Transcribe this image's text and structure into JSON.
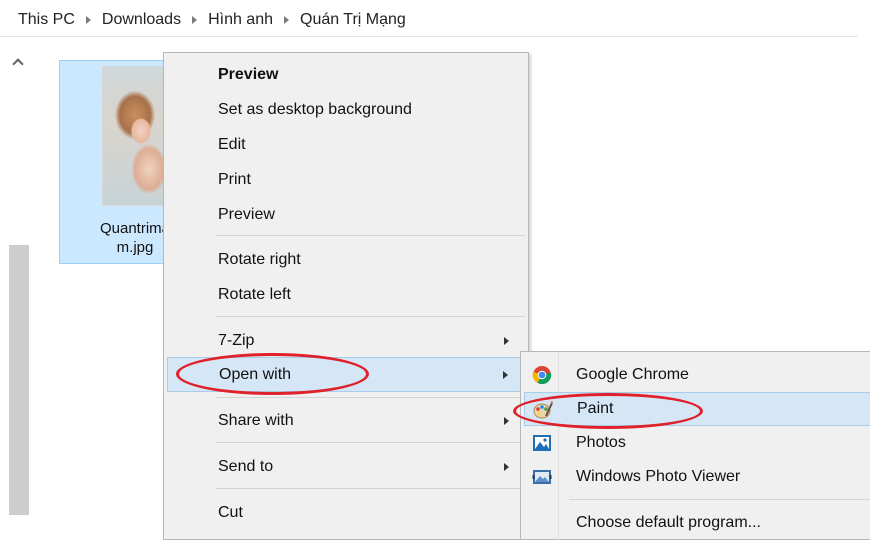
{
  "breadcrumb": {
    "items": [
      "This PC",
      "Downloads",
      "Hình anh",
      "Quán Trị Mạng"
    ]
  },
  "file": {
    "name_line1": "Quantrima",
    "name_line2": "m.jpg"
  },
  "context_menu": {
    "items": [
      {
        "label": "Preview",
        "bold": true
      },
      {
        "label": "Set as desktop background"
      },
      {
        "label": "Edit"
      },
      {
        "label": "Print"
      },
      {
        "label": "Preview"
      },
      {
        "label": "Rotate right"
      },
      {
        "label": "Rotate left"
      },
      {
        "label": "7-Zip",
        "submenu": true
      },
      {
        "label": "Open with",
        "submenu": true,
        "highlighted": true
      },
      {
        "label": "Share with",
        "submenu": true
      },
      {
        "label": "Send to",
        "submenu": true
      },
      {
        "label": "Cut"
      }
    ]
  },
  "open_with_submenu": {
    "items": [
      {
        "label": "Google Chrome",
        "icon": "chrome-icon"
      },
      {
        "label": "Paint",
        "icon": "paint-icon",
        "highlighted": true
      },
      {
        "label": "Photos",
        "icon": "photos-icon"
      },
      {
        "label": "Windows Photo Viewer",
        "icon": "photo-viewer-icon"
      },
      {
        "label": "Choose default program..."
      }
    ]
  },
  "annotation_color": "#e0202a",
  "highlight_color": "#d5e7f7",
  "selection_color": "#cce8ff"
}
